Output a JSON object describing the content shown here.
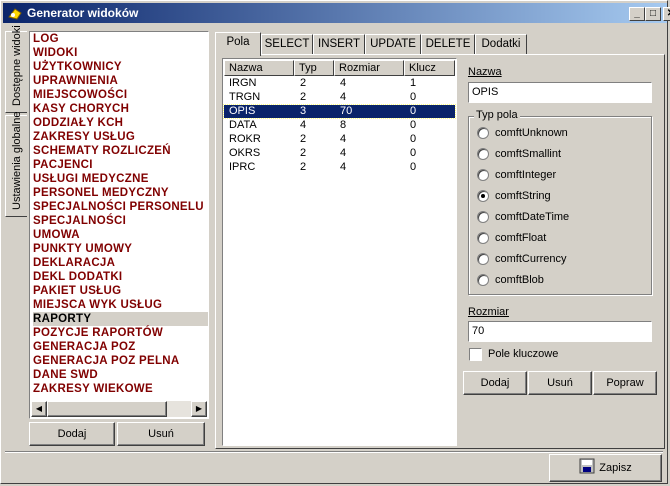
{
  "window": {
    "title": "Generator widoków"
  },
  "side_tabs": [
    "Dostępne widoki",
    "Ustawienia globalne"
  ],
  "views": [
    "LOG",
    "WIDOKI",
    "UŻYTKOWNICY",
    "UPRAWNIENIA",
    "MIEJSCOWOŚCI",
    "KASY CHORYCH",
    "ODDZIAŁY KCH",
    "ZAKRESY USŁUG",
    "SCHEMATY ROZLICZEŃ",
    "PACJENCI",
    "USŁUGI MEDYCZNE",
    "PERSONEL MEDYCZNY",
    "SPECJALNOŚCI PERSONELU",
    "SPECJALNOŚCI",
    "UMOWA",
    "PUNKTY UMOWY",
    "DEKLARACJA",
    "DEKL DODATKI",
    "PAKIET USŁUG",
    "MIEJSCA WYK USŁUG",
    "RAPORTY",
    "POZYCJE RAPORTÓW",
    "GENERACJA POZ",
    "GENERACJA POZ PELNA",
    "DANE SWD",
    "ZAKRESY WIEKOWE"
  ],
  "selected_view_index": 20,
  "left_buttons": {
    "add": "Dodaj",
    "remove": "Usuń"
  },
  "tabs": [
    "Pola",
    "SELECT",
    "INSERT",
    "UPDATE",
    "DELETE",
    "Dodatki"
  ],
  "grid": {
    "headers": [
      "Nazwa",
      "Typ",
      "Rozmiar",
      "Klucz"
    ],
    "rows": [
      [
        "IRGN",
        "2",
        "4",
        "1"
      ],
      [
        "TRGN",
        "2",
        "4",
        "0"
      ],
      [
        "OPIS",
        "3",
        "70",
        "0"
      ],
      [
        "DATA",
        "4",
        "8",
        "0"
      ],
      [
        "ROKR",
        "2",
        "4",
        "0"
      ],
      [
        "OKRS",
        "2",
        "4",
        "0"
      ],
      [
        "IPRC",
        "2",
        "4",
        "0"
      ]
    ],
    "selected_row": 2
  },
  "form": {
    "name_label": "Nazwa",
    "name_value": "OPIS",
    "type_group_label": "Typ pola",
    "types": [
      "comftUnknown",
      "comftSmallint",
      "comftInteger",
      "comftString",
      "comftDateTime",
      "comftFloat",
      "comftCurrency",
      "comftBlob"
    ],
    "selected_type": 3,
    "size_label": "Rozmiar",
    "size_value": "70",
    "key_label": "Pole kluczowe",
    "key_checked": false,
    "btn_add": "Dodaj",
    "btn_remove": "Usuń",
    "btn_fix": "Popraw"
  },
  "save_button": "Zapisz"
}
